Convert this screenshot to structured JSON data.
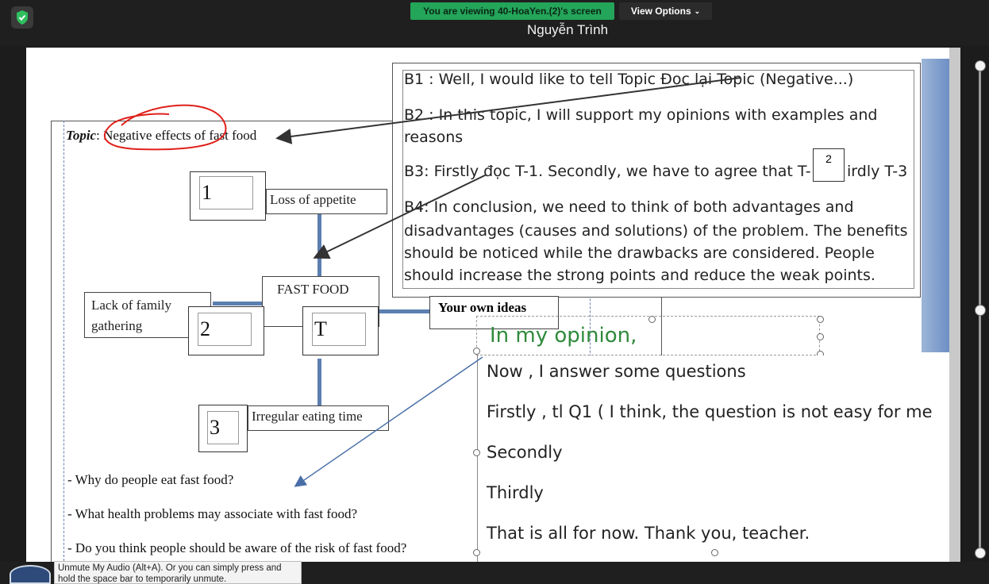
{
  "header": {
    "banner": "You are viewing 40-HoaYen.(2)'s screen",
    "view_options": "View Options",
    "presenter": "Nguyễn Trình"
  },
  "diagram": {
    "topic_prefix": "Topic",
    "topic": "Negative effects of fast food",
    "center_label": "FAST FOOD",
    "center_num": "T",
    "items": [
      {
        "num": "1",
        "label": "Loss of appetite"
      },
      {
        "num": "2",
        "label_line1": "Lack of family",
        "label_line2": "gathering"
      },
      {
        "num": "3",
        "label": "Irregular eating time"
      }
    ],
    "questions": [
      "- Why do people eat fast food?",
      "- What health problems may associate with fast food?",
      "- Do you think people should be aware of the risk of fast food?"
    ],
    "own_ideas": "Your own ideas"
  },
  "textbox": {
    "b1": "B1 : Well, I would like to tell Topic Đọc lại Topic (Negative...)",
    "b2_line1": "B2 : In this topic, I will support my opinions with examples and",
    "b2_line2": "reasons",
    "b3": "B3: Firstly đọc T-1. Secondly, we have to agree that T-",
    "b3_tail": "irdly T-3",
    "b3_box": "2",
    "b4_line1": "B4: In conclusion, we need to think of both advantages and",
    "b4_line2": "disadvantages (causes and solutions) of the problem. The benefits",
    "b4_line3": "should be noticed while the drawbacks are considered. People",
    "b4_line4": "should increase the strong points and reduce the weak points."
  },
  "opinion": {
    "heading": "In my opinion,",
    "lines": [
      "Now , I answer some questions",
      "Firstly , tl Q1 ( I think, the question is not easy for me",
      "Secondly",
      "Thirdly",
      "That is all for now. Thank you, teacher."
    ]
  },
  "footer": {
    "tooltip_line1": "Unmute My Audio (Alt+A). Or you can simply press and",
    "tooltip_line2": "hold the space bar to temporarily unmute."
  },
  "colors": {
    "banner": "#23a55a",
    "opinion": "#2f8a3b",
    "annotation": "#e0201a",
    "arrow": "#333333"
  }
}
